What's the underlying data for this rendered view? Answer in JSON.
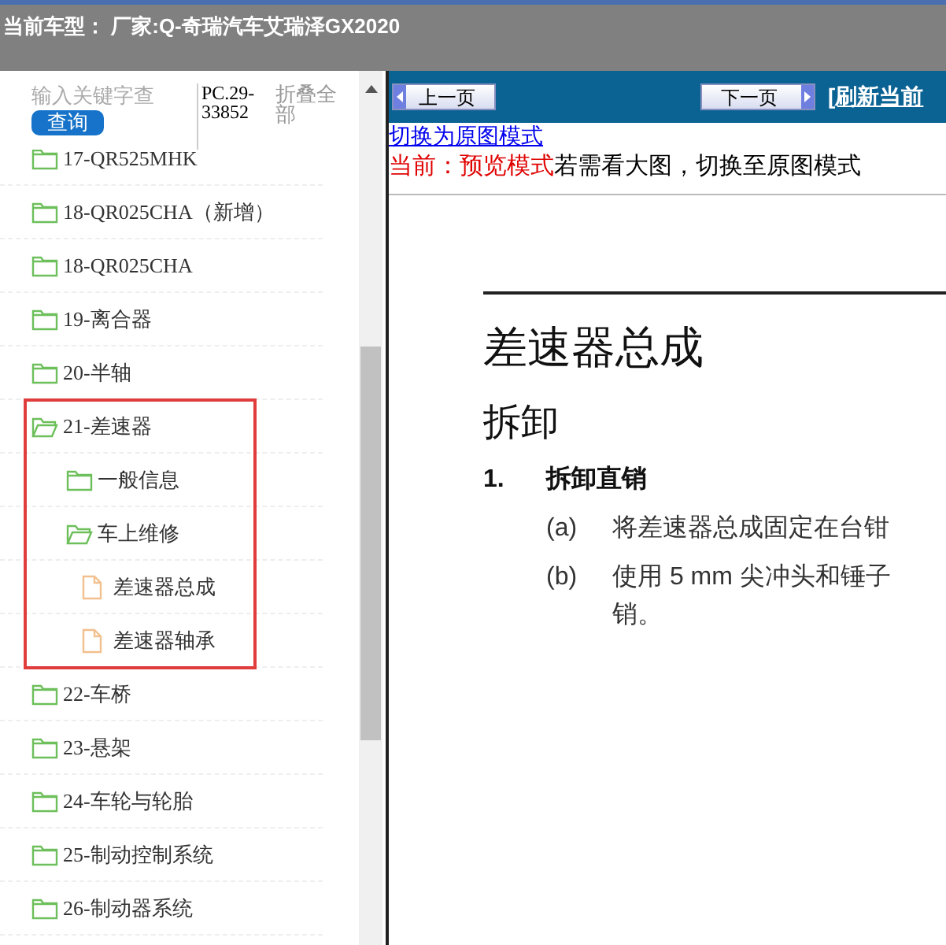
{
  "header": {
    "title": "当前车型： 厂家:Q-奇瑞汽车艾瑞泽GX2020"
  },
  "search": {
    "placeholder": "输入关键字查",
    "button": "查询",
    "code": "PC.29-33852",
    "collapse_all": "折叠全部"
  },
  "tree": [
    {
      "kind": "folder",
      "label": "17-QR525MHK",
      "expanded": false
    },
    {
      "kind": "folder",
      "label": "18-QR025CHA（新增）",
      "expanded": false
    },
    {
      "kind": "folder",
      "label": "18-QR025CHA",
      "expanded": false
    },
    {
      "kind": "folder",
      "label": "19-离合器",
      "expanded": false
    },
    {
      "kind": "folder",
      "label": "20-半轴",
      "expanded": false
    },
    {
      "kind": "folder",
      "label": "21-差速器",
      "expanded": true,
      "children": [
        {
          "kind": "folder",
          "label": "一般信息",
          "expanded": false
        },
        {
          "kind": "folder",
          "label": "车上维修",
          "expanded": true,
          "children": [
            {
              "kind": "file",
              "label": "差速器总成"
            },
            {
              "kind": "file",
              "label": "差速器轴承"
            }
          ]
        }
      ]
    },
    {
      "kind": "folder",
      "label": "22-车桥",
      "expanded": false
    },
    {
      "kind": "folder",
      "label": "23-悬架",
      "expanded": false
    },
    {
      "kind": "folder",
      "label": "24-车轮与轮胎",
      "expanded": false
    },
    {
      "kind": "folder",
      "label": "25-制动控制系统",
      "expanded": false
    },
    {
      "kind": "folder",
      "label": "26-制动器系统",
      "expanded": false
    }
  ],
  "toolbar": {
    "prev": "上一页",
    "next": "下一页",
    "refresh": "[刷新当前"
  },
  "mode": {
    "switch_link": "切换为原图模式",
    "current": "当前：预览模式",
    "hint": "若需看大图，切换至原图模式"
  },
  "document": {
    "title": "差速器总成",
    "section": "拆卸",
    "steps": [
      {
        "number": "1.",
        "title": "拆卸直销",
        "substeps": [
          {
            "label": "(a)",
            "text": "将差速器总成固定在台钳"
          },
          {
            "label": "(b)",
            "text": "使用 5 mm 尖冲头和锤子",
            "continuation": "销。"
          }
        ]
      }
    ]
  }
}
